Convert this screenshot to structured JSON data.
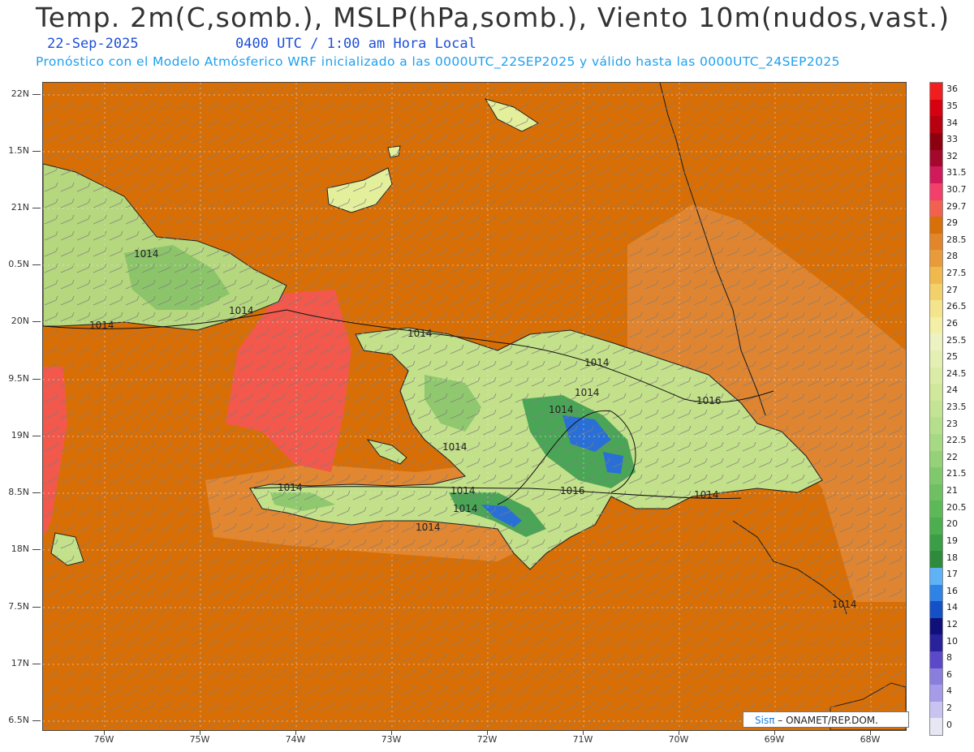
{
  "header": {
    "title": "Temp. 2m(C,somb.), MSLP(hPa,somb.), Viento 10m(nudos,vast.)",
    "date": "22-Sep-2025",
    "time": "0400 UTC / 1:00 am Hora Local",
    "subtitle": "Pronóstico con el Modelo Atmósferico WRF inicializado a las 0000UTC_22SEP2025 y válido hasta las  0000UTC_24SEP2025"
  },
  "map": {
    "lat_labels": [
      "22N",
      "1.5N",
      "21N",
      "0.5N",
      "20N",
      "9.5N",
      "19N",
      "8.5N",
      "18N",
      "7.5N",
      "17N",
      "6.5N"
    ],
    "lon_labels": [
      "76W",
      "75W",
      "74W",
      "73W",
      "72W",
      "71W",
      "70W",
      "69W",
      "68W"
    ],
    "isobar_labels": [
      "1014",
      "1014",
      "1014",
      "1014",
      "1014",
      "1014",
      "1016",
      "1014",
      "1014",
      "1014",
      "1014",
      "1016",
      "1014",
      "1014",
      "1014",
      "1014"
    ],
    "credit_sis": "Sisπ",
    "credit_text": "– ONAMET/REP.DOM.",
    "ocean_color": "#d86f06",
    "land_color": "#c3e08a",
    "warm_color": "#f2584c"
  },
  "colorbar": {
    "labels": [
      "0",
      "2",
      "4",
      "6",
      "8",
      "10",
      "12",
      "14",
      "16",
      "17",
      "18",
      "19",
      "20",
      "20.5",
      "21",
      "21.5",
      "22",
      "22.5",
      "23",
      "23.5",
      "24",
      "24.5",
      "25",
      "25.5",
      "26",
      "26.5",
      "27",
      "27.5",
      "28",
      "28.5",
      "29",
      "29.7",
      "30.7",
      "31.5",
      "32",
      "33",
      "34",
      "35",
      "36"
    ],
    "colors": [
      "#e6e6f5",
      "#c9c3f2",
      "#a69be8",
      "#8a7edc",
      "#5b49c9",
      "#2a229a",
      "#10107a",
      "#1450c6",
      "#2f82e6",
      "#5eb2f5",
      "#2e8b3e",
      "#3a9e46",
      "#4cae4e",
      "#5db858",
      "#6fc062",
      "#80c86c",
      "#94d177",
      "#a7d984",
      "#b6df8c",
      "#c3e492",
      "#cfe89a",
      "#dbeca6",
      "#e4f0b3",
      "#ecf2c2",
      "#f3efa6",
      "#f4e48c",
      "#f2d06a",
      "#efb94e",
      "#e99a3b",
      "#e3852a",
      "#d8700a",
      "#f26050",
      "#f2406a",
      "#d01a5a",
      "#a4082c",
      "#8c0010",
      "#b80010",
      "#d60010",
      "#f01e1e"
    ]
  }
}
